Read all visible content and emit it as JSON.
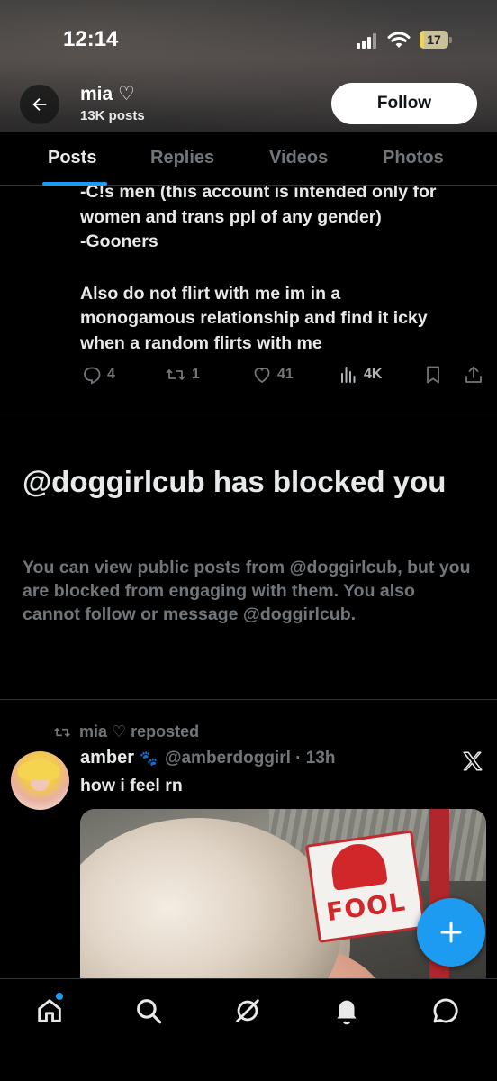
{
  "status_bar": {
    "time": "12:14",
    "battery": "17",
    "battery_level": 0.17
  },
  "profile": {
    "name": "mia ♡",
    "posts_count": "13K posts",
    "follow_label": "Follow"
  },
  "tabs": [
    {
      "label": "Posts",
      "active": true
    },
    {
      "label": "Replies",
      "active": false
    },
    {
      "label": "Videos",
      "active": false
    },
    {
      "label": "Photos",
      "active": false
    }
  ],
  "post1": {
    "lines": [
      "-C!s men (this account is intended only for",
      "women and trans ppl of any gender)",
      "-Gooners",
      "Also do not flirt with me im in a",
      "monogamous relationship and find it icky",
      "when a random flirts with me"
    ],
    "replies": "4",
    "reposts": "1",
    "likes": "41",
    "views": "4K"
  },
  "blocked": {
    "title": "@doggirlcub has blocked you",
    "description": "You can view public posts from @doggirlcub, but you are blocked from engaging with them. You also cannot follow or message @doggirlcub."
  },
  "repost": {
    "reposted_by": "mia ♡ reposted",
    "author_name": "amber",
    "author_emoji": "🐾",
    "handle_time": "@amberdoggirl · 13h",
    "text": "how i feel rn",
    "sign_text": "FOOL"
  },
  "colors": {
    "accent": "#1d9bf0",
    "muted": "#71767b",
    "text": "#e7e9ea",
    "background": "#000000"
  },
  "bottom_nav": [
    "home-icon",
    "search-icon",
    "grok-icon",
    "notifications-icon",
    "messages-icon"
  ]
}
